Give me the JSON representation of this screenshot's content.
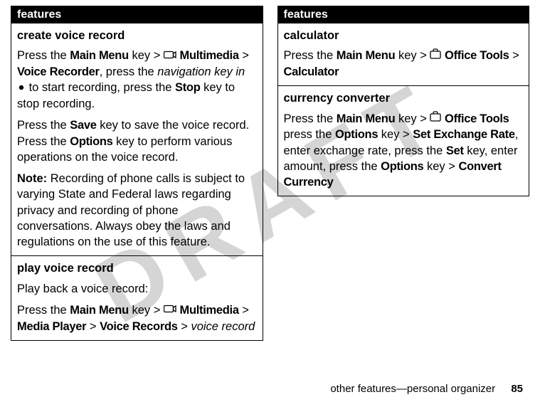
{
  "watermark": "DRAFT",
  "left": {
    "header": "features",
    "cells": [
      {
        "title": "create voice record",
        "paragraphs": [
          {
            "runs": [
              {
                "t": "Press the "
              },
              {
                "t": "Main Menu",
                "b": true,
                "c": true
              },
              {
                "t": " key > "
              },
              {
                "icon": "multimedia"
              },
              {
                "t": " "
              },
              {
                "t": "Multimedia",
                "b": true,
                "c": true
              },
              {
                "t": " > "
              },
              {
                "t": "Voice Recorder",
                "b": true,
                "c": true
              },
              {
                "t": ", press the "
              },
              {
                "t": "navigation key in",
                "i": true
              },
              {
                "t": " "
              },
              {
                "icon": "dot"
              },
              {
                "t": " to start recording, press the "
              },
              {
                "t": "Stop",
                "b": true,
                "c": true
              },
              {
                "t": " key to stop recording."
              }
            ]
          },
          {
            "runs": [
              {
                "t": "Press the "
              },
              {
                "t": "Save",
                "b": true,
                "c": true
              },
              {
                "t": " key to save the voice record. Press the "
              },
              {
                "t": "Options",
                "b": true,
                "c": true
              },
              {
                "t": " key to perform various operations on the voice record."
              }
            ]
          },
          {
            "runs": [
              {
                "t": "Note:",
                "b": true
              },
              {
                "t": " Recording of phone calls is subject to varying State and Federal laws regarding privacy and recording of phone conversations. Always obey the laws and regulations on the use of this feature."
              }
            ]
          }
        ]
      },
      {
        "title": "play voice record",
        "paragraphs": [
          {
            "runs": [
              {
                "t": "Play back a voice record:"
              }
            ]
          },
          {
            "runs": [
              {
                "t": "Press the "
              },
              {
                "t": "Main Menu",
                "b": true,
                "c": true
              },
              {
                "t": " key > "
              },
              {
                "icon": "multimedia"
              },
              {
                "t": " "
              },
              {
                "t": "Multimedia",
                "b": true,
                "c": true
              },
              {
                "t": " > "
              },
              {
                "t": "Media Player",
                "b": true,
                "c": true
              },
              {
                "t": " > "
              },
              {
                "t": "Voice Records",
                "b": true,
                "c": true
              },
              {
                "t": " > "
              },
              {
                "t": "voice record",
                "i": true
              }
            ]
          }
        ]
      }
    ]
  },
  "right": {
    "header": "features",
    "cells": [
      {
        "title": "calculator",
        "paragraphs": [
          {
            "runs": [
              {
                "t": "Press the "
              },
              {
                "t": "Main Menu",
                "b": true,
                "c": true
              },
              {
                "t": " key > "
              },
              {
                "icon": "office"
              },
              {
                "t": " "
              },
              {
                "t": "Office Tools",
                "b": true,
                "c": true
              },
              {
                "t": " > "
              },
              {
                "t": "Calculator",
                "b": true,
                "c": true
              }
            ]
          }
        ]
      },
      {
        "title": "currency converter",
        "paragraphs": [
          {
            "runs": [
              {
                "t": "Press the "
              },
              {
                "t": "Main Menu",
                "b": true,
                "c": true
              },
              {
                "t": " key > "
              },
              {
                "icon": "office"
              },
              {
                "t": " "
              },
              {
                "t": "Office Tools",
                "b": true,
                "c": true
              },
              {
                "t": " press the "
              },
              {
                "t": "Options",
                "b": true,
                "c": true
              },
              {
                "t": " key > "
              },
              {
                "t": "Set Exchange Rate",
                "b": true,
                "c": true
              },
              {
                "t": ", enter exchange rate, press the "
              },
              {
                "t": "Set",
                "b": true,
                "c": true
              },
              {
                "t": " key, enter amount, press the "
              },
              {
                "t": "Options",
                "b": true,
                "c": true
              },
              {
                "t": " key > "
              },
              {
                "t": "Convert Currency",
                "b": true,
                "c": true
              }
            ]
          }
        ]
      }
    ]
  },
  "footer": {
    "text": "other features—personal organizer",
    "page": "85"
  }
}
